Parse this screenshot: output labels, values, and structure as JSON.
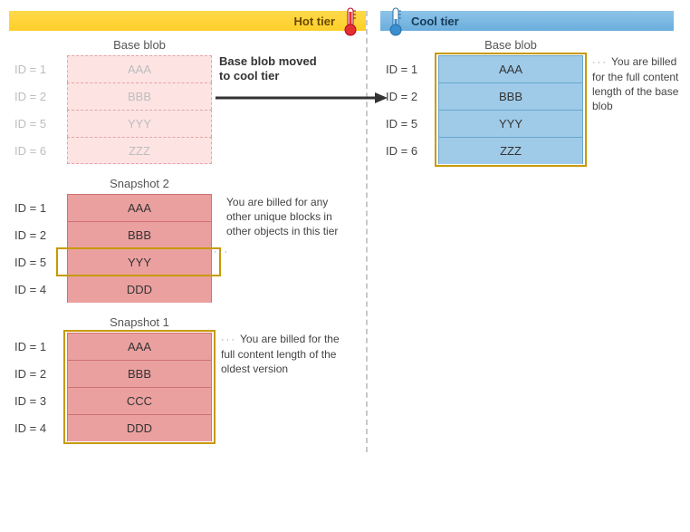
{
  "hot": {
    "label": "Hot tier",
    "arrow_label_l1": "Base blob moved",
    "arrow_label_l2": "to cool tier",
    "base": {
      "title": "Base blob",
      "rows": [
        {
          "id": "ID = 1",
          "v": "AAA"
        },
        {
          "id": "ID = 2",
          "v": "BBB"
        },
        {
          "id": "ID = 5",
          "v": "YYY"
        },
        {
          "id": "ID = 6",
          "v": "ZZZ"
        }
      ]
    },
    "snap2": {
      "title": "Snapshot 2",
      "caption": "You are billed for any other unique blocks in other objects in this tier",
      "rows": [
        {
          "id": "ID = 1",
          "v": "AAA"
        },
        {
          "id": "ID = 2",
          "v": "BBB"
        },
        {
          "id": "ID = 5",
          "v": "YYY"
        },
        {
          "id": "ID = 4",
          "v": "DDD"
        }
      ]
    },
    "snap1": {
      "title": "Snapshot 1",
      "caption": "You are billed for the full content length of the oldest version",
      "rows": [
        {
          "id": "ID = 1",
          "v": "AAA"
        },
        {
          "id": "ID = 2",
          "v": "BBB"
        },
        {
          "id": "ID = 3",
          "v": "CCC"
        },
        {
          "id": "ID = 4",
          "v": "DDD"
        }
      ]
    }
  },
  "cool": {
    "label": "Cool tier",
    "base": {
      "title": "Base blob",
      "caption": "You are billed for the full content length of the base blob",
      "rows": [
        {
          "id": "ID = 1",
          "v": "AAA"
        },
        {
          "id": "ID = 2",
          "v": "BBB"
        },
        {
          "id": "ID = 5",
          "v": "YYY"
        },
        {
          "id": "ID = 6",
          "v": "ZZZ"
        }
      ]
    }
  }
}
